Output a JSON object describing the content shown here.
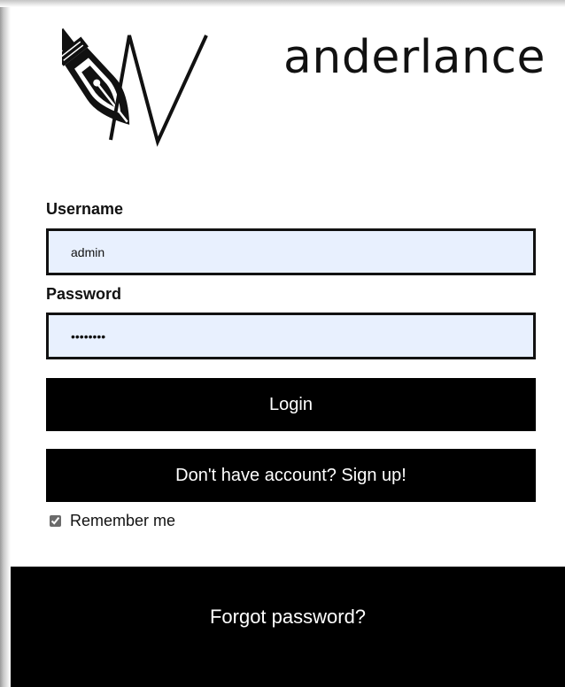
{
  "brand": {
    "name": "anderlance"
  },
  "login_form": {
    "username_label": "Username",
    "username_value": "admin",
    "password_label": "Password",
    "password_value": "wanderer",
    "login_label": "Login",
    "signup_label": "Don't have account? Sign up!",
    "remember_label": "Remember me",
    "remember_checked": true
  },
  "footer": {
    "forgot_label": "Forgot password?"
  },
  "colors": {
    "button_bg": "#000000",
    "input_bg": "#e8f0fe",
    "text": "#111111"
  }
}
